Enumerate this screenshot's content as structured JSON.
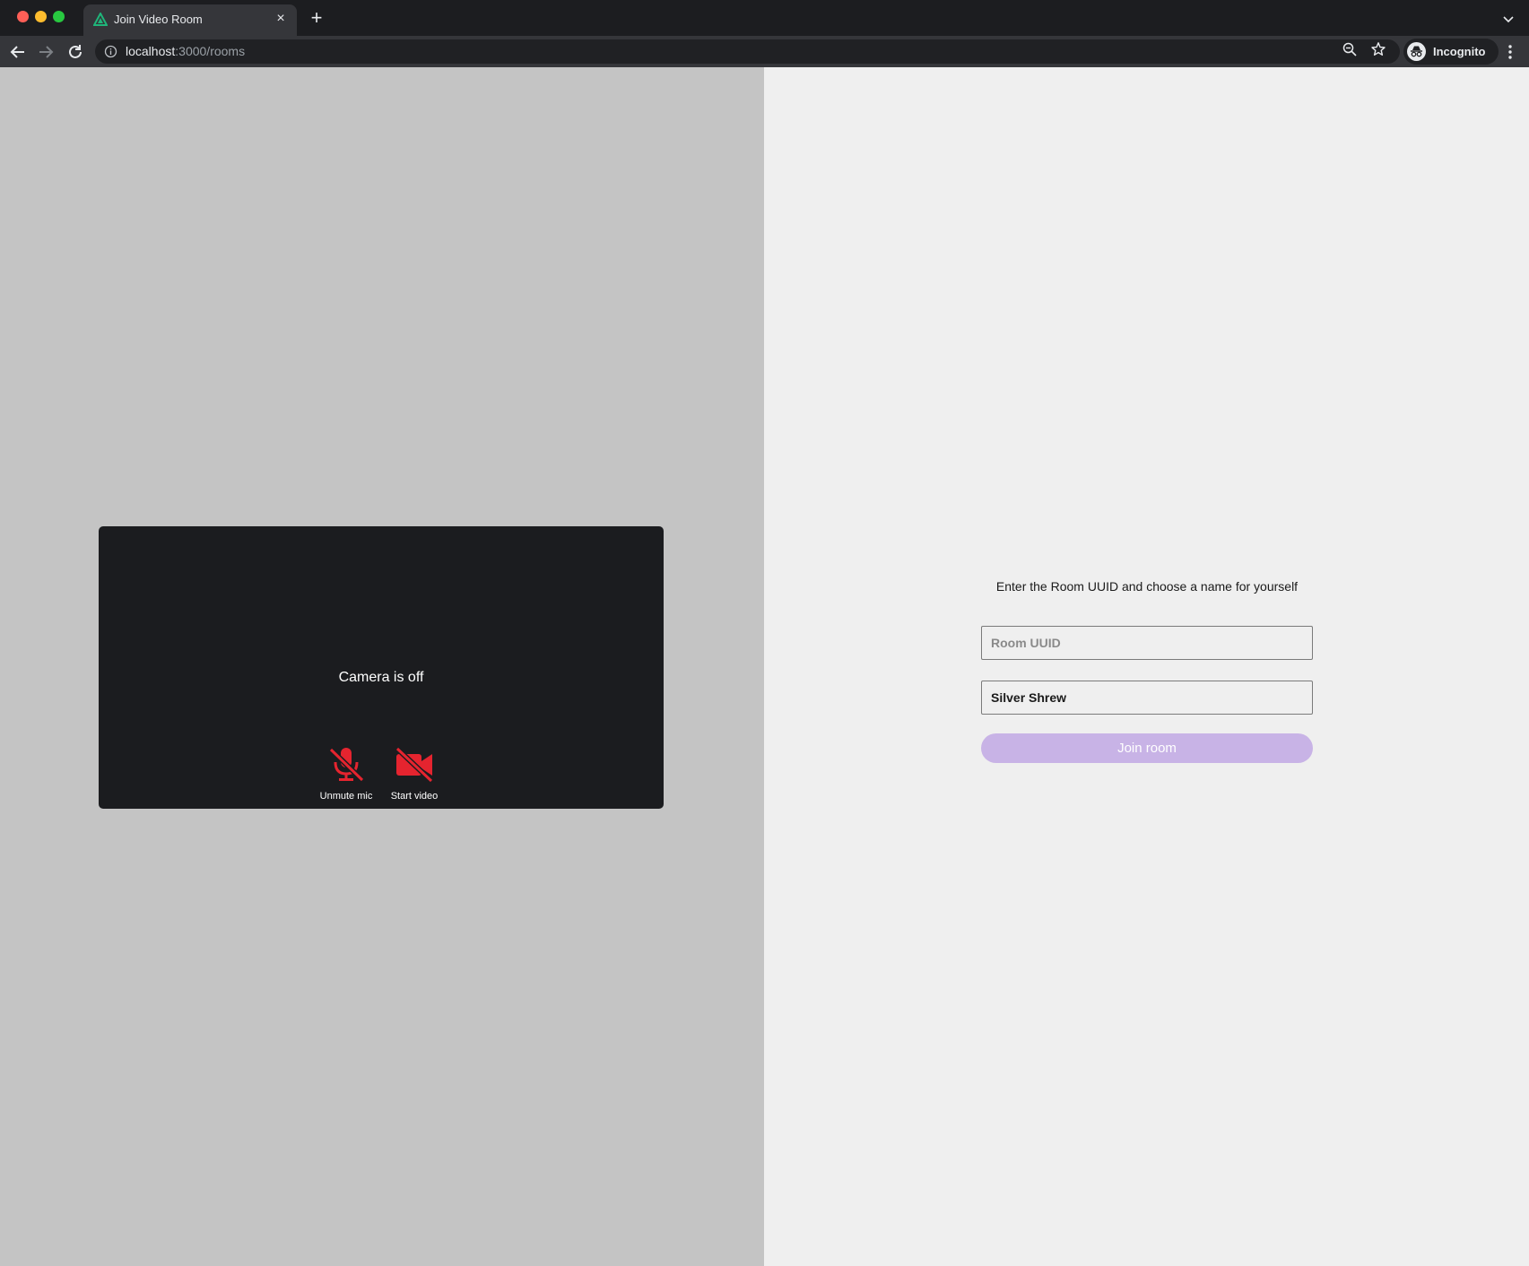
{
  "browser": {
    "tab": {
      "title": "Join Video Room",
      "favicon": "green-triangle-logo",
      "close_label": "×"
    },
    "new_tab_label": "+",
    "address": {
      "host": "localhost",
      "path": ":3000/rooms"
    },
    "profile_label": "Incognito"
  },
  "preview": {
    "status_text": "Camera is off",
    "controls": [
      {
        "label": "Unmute mic",
        "icon": "mic-off-icon",
        "color": "#e5242f"
      },
      {
        "label": "Start video",
        "icon": "video-off-icon",
        "color": "#e5242f"
      }
    ]
  },
  "form": {
    "prompt": "Enter the Room UUID and choose a name for yourself",
    "room_uuid": {
      "placeholder": "Room UUID",
      "value": ""
    },
    "display_name": {
      "value": "Silver Shrew"
    },
    "join_button_label": "Join room",
    "join_button_color": "#c8b3e6"
  }
}
